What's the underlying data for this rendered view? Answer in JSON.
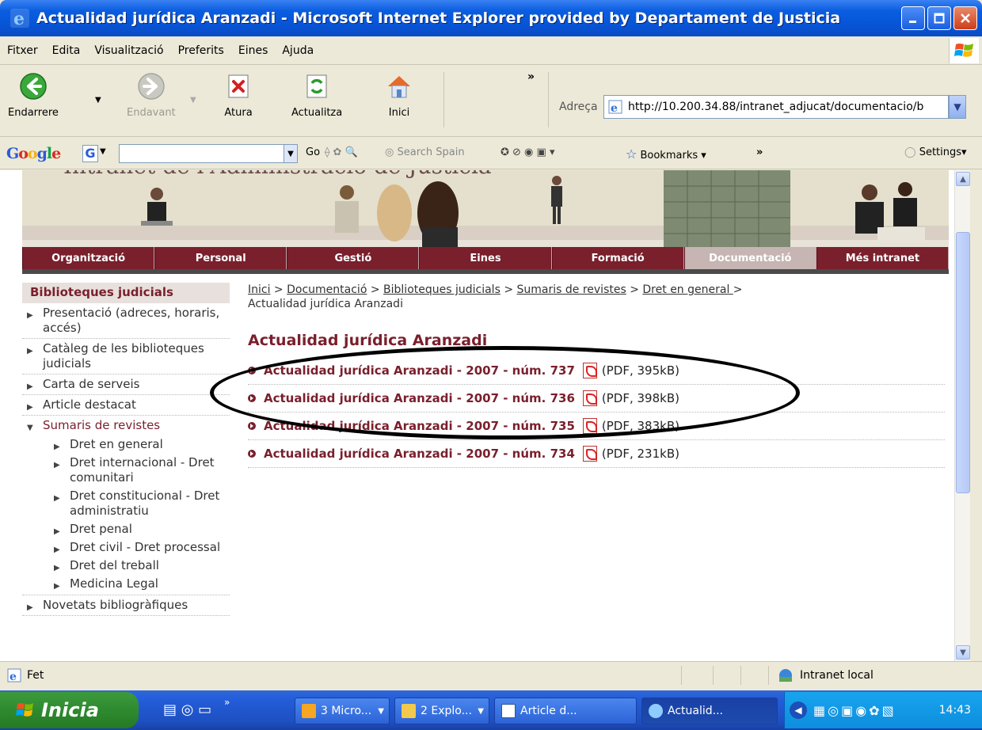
{
  "window": {
    "title": "Actualidad jurídica Aranzadi - Microsoft Internet Explorer provided by Departament de Justicia"
  },
  "menu": [
    "Fitxer",
    "Edita",
    "Visualització",
    "Preferits",
    "Eines",
    "Ajuda"
  ],
  "toolbar": {
    "back": "Endarrere",
    "forward": "Endavant",
    "stop": "Atura",
    "refresh": "Actualitza",
    "home": "Inici",
    "more": "»",
    "address_label": "Adreça",
    "address_value": "http://10.200.34.88/intranet_adjucat/documentacio/b"
  },
  "googlebar": {
    "logo": "Google",
    "go": "Go",
    "search_site": "Search Spain",
    "bookmarks": "Bookmarks",
    "more": "»",
    "settings": "Settings"
  },
  "banner": {
    "ghost_title": "Intranet de l'Administració de Justícia"
  },
  "nav": [
    {
      "label": "Organització"
    },
    {
      "label": "Personal"
    },
    {
      "label": "Gestió"
    },
    {
      "label": "Eines"
    },
    {
      "label": "Formació"
    },
    {
      "label": "Documentació",
      "active": true
    },
    {
      "label": "Més intranet"
    }
  ],
  "sidebar": {
    "heading": "Biblioteques judicials",
    "items": [
      "Presentació (adreces, horaris, accés)",
      "Catàleg de les biblioteques judicials",
      "Carta de serveis",
      "Article destacat"
    ],
    "open_item": "Sumaris de revistes",
    "sub_items": [
      "Dret en general",
      "Dret internacional - Dret comunitari",
      "Dret constitucional - Dret administratiu",
      "Dret penal",
      "Dret civil - Dret processal",
      "Dret del treball",
      "Medicina Legal"
    ],
    "after_item": "Novetats bibliogràfiques"
  },
  "breadcrumb": {
    "links": [
      "Inici",
      "Documentació",
      "Biblioteques judicials",
      "Sumaris de revistes",
      "Dret en general "
    ],
    "separator": " > ",
    "current": "Actualidad jurídica Aranzadi"
  },
  "page_title": "Actualidad jurídica Aranzadi",
  "documents": [
    {
      "title": "Actualidad jurídica Aranzadi - 2007 - núm. 737",
      "size": "(PDF, 395kB)"
    },
    {
      "title": "Actualidad jurídica Aranzadi - 2007 - núm. 736",
      "size": "(PDF, 398kB)"
    },
    {
      "title": "Actualidad jurídica Aranzadi - 2007 - núm. 735",
      "size": "(PDF, 383kB)"
    },
    {
      "title": "Actualidad jurídica Aranzadi - 2007 - núm. 734",
      "size": "(PDF, 231kB)"
    }
  ],
  "status": {
    "text": "Fet",
    "zone": "Intranet local"
  },
  "taskbar": {
    "start": "Inicia",
    "tasks": [
      {
        "label": "3 Micro...",
        "icon": "outlook-icon"
      },
      {
        "label": "2 Explo...",
        "icon": "folder-icon"
      },
      {
        "label": "Article d...",
        "icon": "word-icon"
      },
      {
        "label": "Actualid...",
        "icon": "ie-icon",
        "active": true
      }
    ],
    "clock": "14:43"
  },
  "colors": {
    "brand": "#7a1f2c",
    "xp_blue": "#0754d6",
    "start_green": "#2f8a2f"
  }
}
